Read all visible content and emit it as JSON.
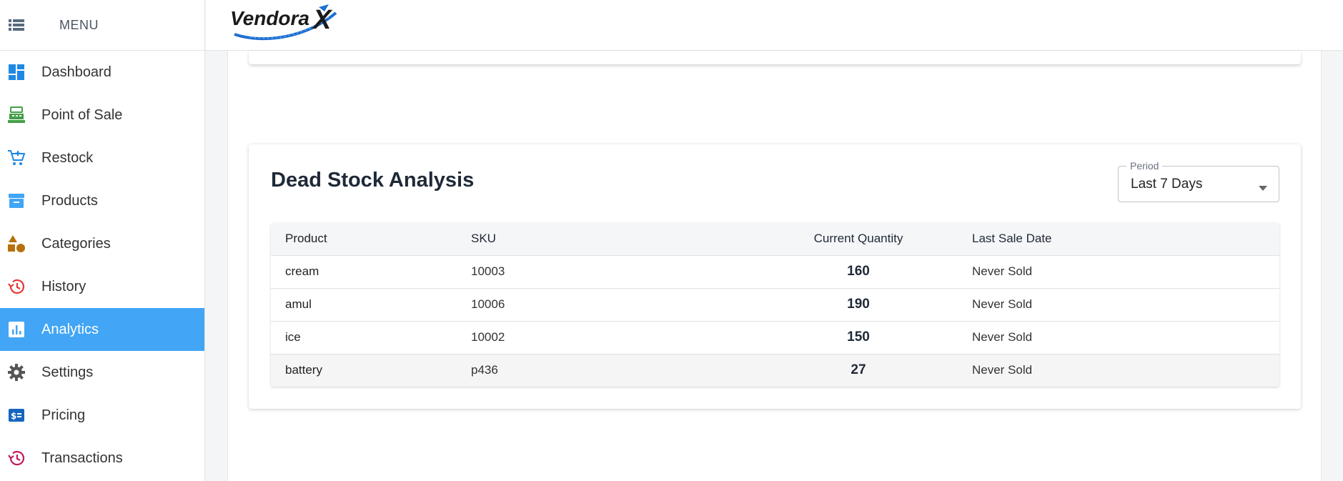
{
  "sidebar": {
    "menu_label": "MENU",
    "items": [
      {
        "label": "Dashboard",
        "icon": "dashboard-icon",
        "color": "#1e88e5"
      },
      {
        "label": "Point of Sale",
        "icon": "cash-register-icon",
        "color": "#43a047"
      },
      {
        "label": "Restock",
        "icon": "cart-add-icon",
        "color": "#1e88e5"
      },
      {
        "label": "Products",
        "icon": "archive-box-icon",
        "color": "#42a5f5"
      },
      {
        "label": "Categories",
        "icon": "shapes-icon",
        "color": "#b7700c"
      },
      {
        "label": "History",
        "icon": "history-icon",
        "color": "#e53935"
      },
      {
        "label": "Analytics",
        "icon": "analytics-icon",
        "color": "#ffffff",
        "active": true
      },
      {
        "label": "Settings",
        "icon": "gear-icon",
        "color": "#555555"
      },
      {
        "label": "Pricing",
        "icon": "pricing-icon",
        "color": "#1565c0"
      },
      {
        "label": "Transactions",
        "icon": "transactions-icon",
        "color": "#c2185b"
      }
    ]
  },
  "header": {
    "logo_text": "Vendora",
    "logo_mark": "X"
  },
  "dead_stock": {
    "title": "Dead Stock Analysis",
    "period": {
      "legend": "Period",
      "value": "Last 7 Days"
    },
    "columns": [
      "Product",
      "SKU",
      "Current Quantity",
      "Last Sale Date"
    ],
    "rows": [
      {
        "product": "cream",
        "sku": "10003",
        "quantity": "160",
        "last_sale": "Never Sold"
      },
      {
        "product": "amul",
        "sku": "10006",
        "quantity": "190",
        "last_sale": "Never Sold"
      },
      {
        "product": "ice",
        "sku": "10002",
        "quantity": "150",
        "last_sale": "Never Sold"
      },
      {
        "product": "battery",
        "sku": "p436",
        "quantity": "27",
        "last_sale": "Never Sold"
      }
    ]
  }
}
